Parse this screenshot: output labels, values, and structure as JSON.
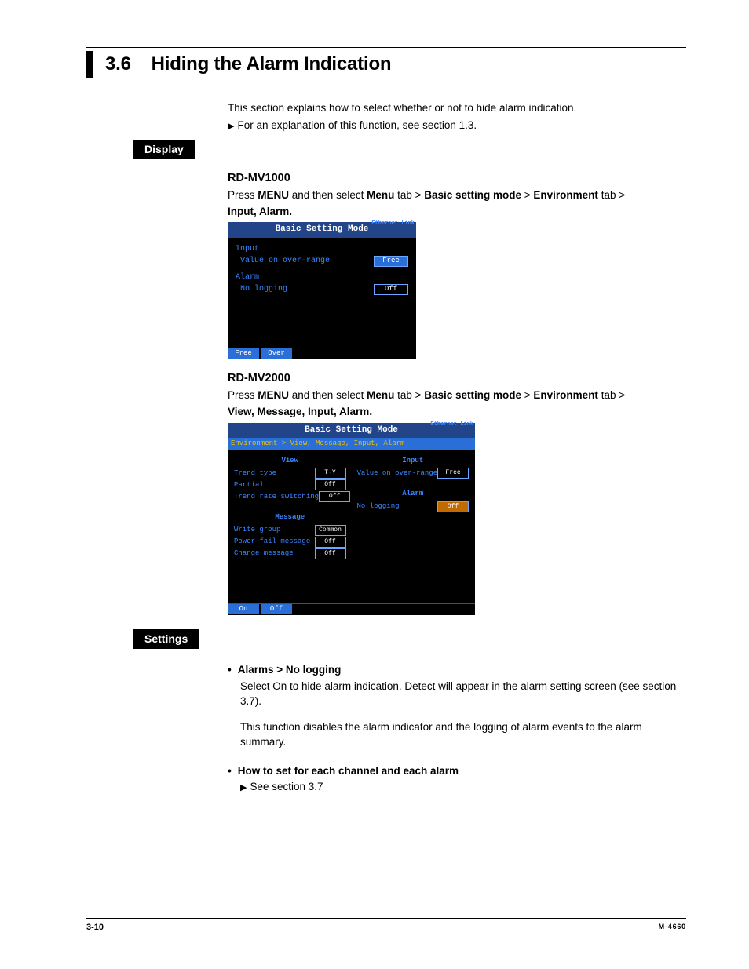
{
  "section_number": "3.6",
  "section_title": "Hiding the Alarm Indication",
  "intro_line": "This section explains how to select whether or not to hide alarm indication.",
  "intro_ref": "For an explanation of this function, see section 1.3.",
  "display_tag": "Display",
  "settings_tag": "Settings",
  "mv1000": {
    "model": "RD-MV1000",
    "press_prefix": "Press ",
    "menu_word": "MENU",
    "between": " and then select ",
    "path_parts": [
      "Menu",
      " tab > ",
      "Basic setting mode",
      " > ",
      "Environment",
      " tab > "
    ],
    "path_tail": "Input, Alarm",
    "shot": {
      "title": "Basic Setting Mode",
      "eth": "Ethernet\nLink",
      "groups": [
        {
          "heading": "Input",
          "rows": [
            {
              "label": "Value on over-range",
              "value": "Free",
              "selected": true
            }
          ]
        },
        {
          "heading": "Alarm",
          "rows": [
            {
              "label": "No logging",
              "value": "Off",
              "selected": false
            }
          ]
        }
      ],
      "footer_buttons": [
        "Free",
        "Over"
      ]
    }
  },
  "mv2000": {
    "model": "RD-MV2000",
    "press_prefix": "Press ",
    "menu_word": "MENU",
    "between": " and then select ",
    "path_parts": [
      "Menu",
      " tab > ",
      "Basic setting mode",
      " > ",
      "Environment",
      " tab > "
    ],
    "path_tail": "View, Message, Input, Alarm",
    "shot": {
      "title": "Basic Setting Mode",
      "eth": "Ethernet\nLink",
      "crumb": "Environment > View, Message, Input, Alarm",
      "left_groups": [
        {
          "heading": "View",
          "rows": [
            {
              "label": "Trend type",
              "value": "T-Y"
            },
            {
              "label": "Partial",
              "value": "Off"
            },
            {
              "label": "Trend rate switching",
              "value": "Off"
            }
          ]
        },
        {
          "heading": "Message",
          "rows": [
            {
              "label": "Write group",
              "value": "Common"
            },
            {
              "label": "Power-fail message",
              "value": "Off"
            },
            {
              "label": "Change message",
              "value": "Off"
            }
          ]
        }
      ],
      "right_groups": [
        {
          "heading": "Input",
          "rows": [
            {
              "label": "Value on over-range",
              "value": "Free"
            }
          ]
        },
        {
          "heading": "Alarm",
          "rows": [
            {
              "label": "No logging",
              "value": "Off",
              "orange": true
            }
          ]
        }
      ],
      "footer_buttons": [
        "On",
        "Off"
      ]
    }
  },
  "settings": {
    "item1_title": "Alarms > No logging",
    "item1_body1": "Select On to hide alarm indication. Detect will appear in the alarm setting screen (see section 3.7).",
    "item1_body2": "This function disables the alarm indicator and the logging of alarm events to the alarm summary.",
    "item2_title": "How to set for each channel and each alarm",
    "item2_ref": "See section 3.7"
  },
  "footer": {
    "page": "3-10",
    "doc": "M-4660"
  }
}
